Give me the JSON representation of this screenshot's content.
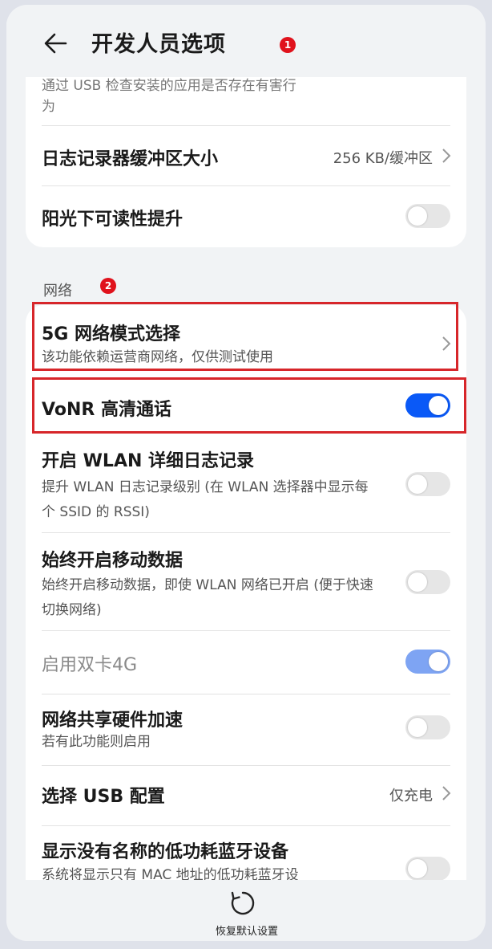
{
  "header": {
    "title": "开发人员选项",
    "badge": "1"
  },
  "top_card": {
    "partial_text_line1": "通过 USB 检查安装的应用是否存在有害行",
    "partial_text_line2": "为",
    "log_buffer": {
      "title": "日志记录器缓冲区大小",
      "value": "256 KB/缓冲区"
    },
    "sunlight": {
      "title": "阳光下可读性提升",
      "state": "off"
    }
  },
  "network_section": {
    "label": "网络",
    "badge": "2",
    "items": [
      {
        "title": "5G 网络模式选择",
        "subtitle": "该功能依赖运营商网络，仅供测试使用"
      },
      {
        "title": "VoNR 高清通话",
        "state": "on"
      },
      {
        "title": "开启 WLAN 详细日志记录",
        "subtitle": "提升 WLAN 日志记录级别 (在 WLAN 选择器中显示每个 SSID 的 RSSI)",
        "state": "off"
      },
      {
        "title": "始终开启移动数据",
        "subtitle": "始终开启移动数据，即使 WLAN 网络已开启 (便于快速切换网络)",
        "state": "off"
      },
      {
        "title": "启用双卡4G",
        "state": "on-disabled"
      },
      {
        "title": "网络共享硬件加速",
        "subtitle": "若有此功能则启用",
        "state": "off"
      },
      {
        "title": "选择 USB 配置",
        "value": "仅充电"
      },
      {
        "title": "显示没有名称的低功耗蓝牙设备",
        "subtitle": "系统将显示只有 MAC 地址的低功耗蓝牙设",
        "state": "off"
      }
    ]
  },
  "bottom_bar": {
    "reset_label": "恢复默认设置",
    "icon": "reset-icon"
  },
  "colors": {
    "accent": "#0a59f7",
    "highlight": "#d7262a",
    "badge": "#e0121c",
    "background": "#f1f3f5"
  }
}
